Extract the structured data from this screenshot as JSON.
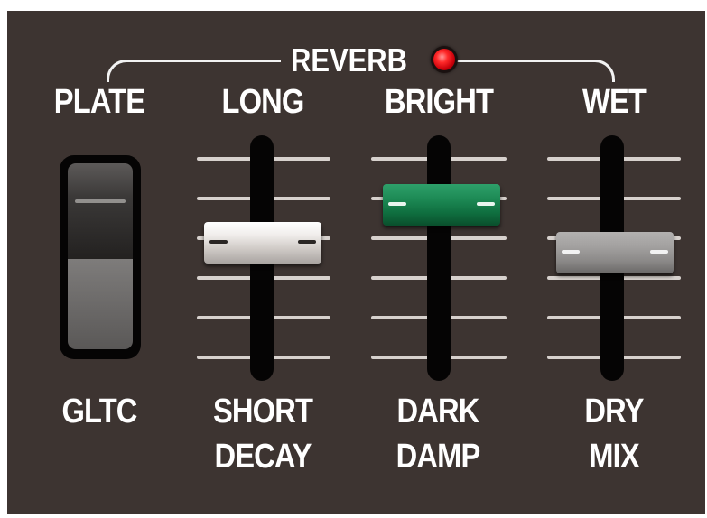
{
  "section": {
    "title": "REVERB",
    "led": {
      "state": "on",
      "color": "#ff2a2a"
    }
  },
  "switch": {
    "top_label": "PLATE",
    "bottom_label": "GLTC",
    "position": "bottom"
  },
  "faders": [
    {
      "top_label": "LONG",
      "bottom_label_1": "SHORT",
      "bottom_label_2": "DECAY",
      "cap_color": "white",
      "level": 0.6
    },
    {
      "top_label": "BRIGHT",
      "bottom_label_1": "DARK",
      "bottom_label_2": "DAMP",
      "cap_color": "green",
      "level": 0.8
    },
    {
      "top_label": "WET",
      "bottom_label_1": "DRY",
      "bottom_label_2": "MIX",
      "cap_color": "grey",
      "level": 0.55
    }
  ]
}
